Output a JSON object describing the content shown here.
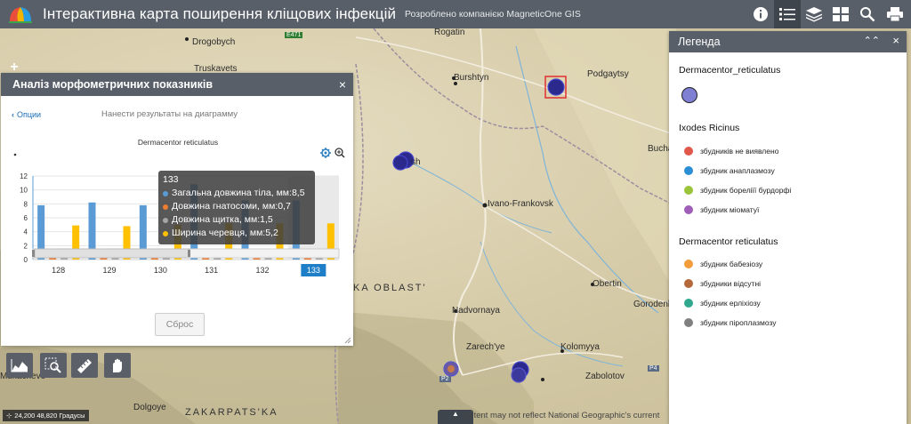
{
  "header": {
    "title": "Інтерактивна карта поширення кліщових інфекцій",
    "subtitle": "Розроблено компанією MagneticOne GIS",
    "buttons": [
      "info-icon",
      "legend-list-icon",
      "layers-icon",
      "basemap-gallery-icon",
      "search-icon",
      "print-icon"
    ]
  },
  "map": {
    "labels": {
      "drogobych": "Drogobych",
      "truskavets": "Truskavets",
      "rogatin": "Rogatin",
      "burshtyn": "Burshtyn",
      "podgaytsy": "Podgaytsy",
      "ivano_frankovsk": "Ivano-Frankovsk",
      "bucha": "Bucha",
      "obertin": "Obertin",
      "oblast": "KA OBLAST'",
      "gorodenka": "Gorodenka",
      "nadvornaya": "Nadvornaya",
      "zarechye": "Zarech'ye",
      "kolomyya": "Kolomyya",
      "zabolotov": "Zabolotov",
      "zakarpatska": "ZAKARPATS'KA",
      "dolgoye": "Dolgoye",
      "mukachevo": "Mukachevo",
      "sh": "sh",
      "e471": "E471",
      "p4": "P4",
      "p2": "P2"
    },
    "zoom_in": "+",
    "zoom_out": "−",
    "coordinates": "24,200 48,820 Градусы",
    "attribution": "ontent may not reflect National Geographic's current"
  },
  "analysis_panel": {
    "title": "Аналіз морфометричних показників",
    "close": "×",
    "options_link": "Опции",
    "instruction": "Нанести результаты на диаграмму",
    "reset_label": "Сброс"
  },
  "chart_data": {
    "type": "bar",
    "title": "Dermacentor reticulatus",
    "categories": [
      "128",
      "129",
      "130",
      "131",
      "132",
      "133"
    ],
    "y_ticks": [
      "0",
      "2",
      "4",
      "6",
      "8",
      "10",
      "12"
    ],
    "ylim": [
      0,
      12
    ],
    "selected_category": "133",
    "series": [
      {
        "name": "Загальна довжина тіла, мм",
        "color": "#5b9bd5",
        "values": [
          7.8,
          8.2,
          7.8,
          10.8,
          8.5,
          8.5
        ]
      },
      {
        "name": "Довжина гнатосоми, мм",
        "color": "#ed7d31",
        "values": [
          0.8,
          0.8,
          0.7,
          0.7,
          0.7,
          0.7
        ]
      },
      {
        "name": "Довжина щитка, мм",
        "color": "#a5a5a5",
        "values": [
          1.6,
          1.6,
          1.5,
          1.5,
          1.5,
          1.5
        ]
      },
      {
        "name": "Ширина черевця, мм",
        "color": "#ffc000",
        "values": [
          4.9,
          4.8,
          5.0,
          5.2,
          5.2,
          5.2
        ]
      }
    ],
    "tooltip": {
      "title": "133",
      "rows": [
        "Загальна довжина тіла, мм:8,5",
        "Довжина гнатосоми, мм:0,7",
        "Довжина щитка, мм:1,5",
        "Ширина черевця, мм:5,2"
      ],
      "colors": [
        "#5b9bd5",
        "#ed7d31",
        "#a5a5a5",
        "#ffc000"
      ]
    }
  },
  "legend": {
    "title": "Легенда",
    "groups": [
      {
        "title": "Dermacentor_reticulatus",
        "items": []
      },
      {
        "title": "Ixodes Ricinus",
        "items": [
          {
            "label": "збудників не виявлено",
            "color": "#e0584b"
          },
          {
            "label": "збудник анаплазмозу",
            "color": "#2a8fd4"
          },
          {
            "label": "збудник бореліїї бурдорфі",
            "color": "#9ac43a"
          },
          {
            "label": "збудник міоматуї",
            "color": "#a15eb8"
          }
        ]
      },
      {
        "title": "Dermacentor reticulatus",
        "items": [
          {
            "label": "збудник бабезіозу",
            "color": "#f39c3b"
          },
          {
            "label": "збудники відсутні",
            "color": "#b5683a"
          },
          {
            "label": "збудник ерліхіозу",
            "color": "#2fa88e"
          },
          {
            "label": "збудник піроплазмозу",
            "color": "#808080"
          }
        ]
      }
    ],
    "symbol_color": "#7f7fd4"
  },
  "tools": [
    "elevation-profile-icon",
    "zoom-select-icon",
    "measure-icon",
    "draw-icon"
  ]
}
